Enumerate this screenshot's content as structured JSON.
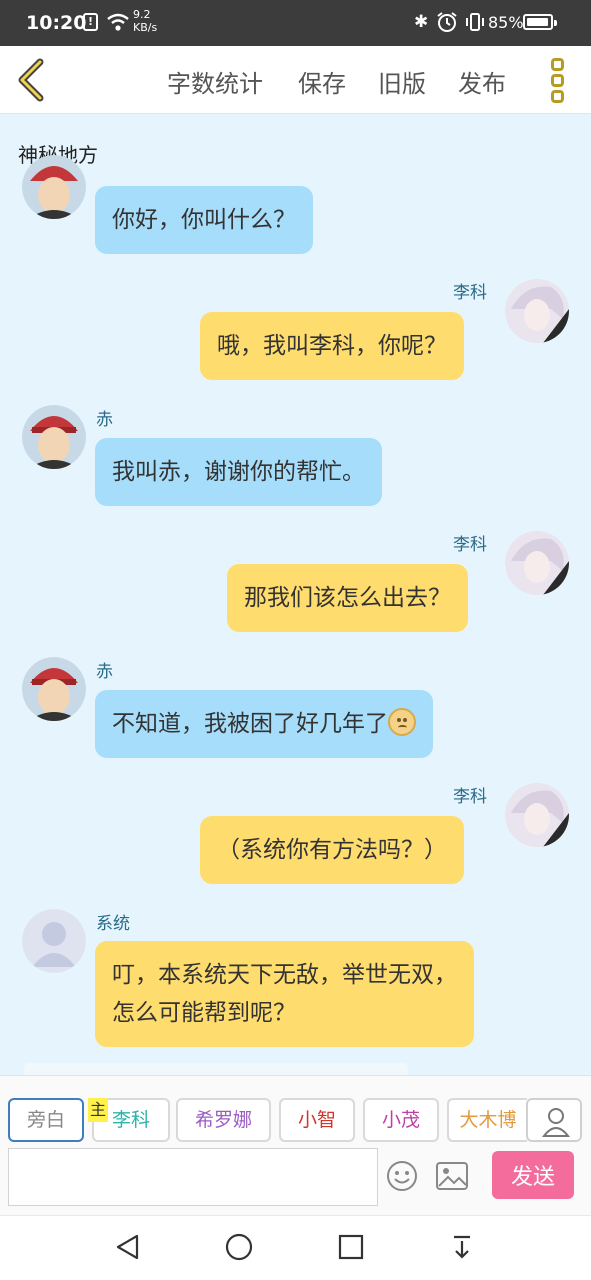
{
  "status_bar": {
    "time": "10:20",
    "alert_glyph": "!",
    "net_speed_value": "9.2",
    "net_speed_unit": "KB/s",
    "bluetooth_glyph": "✱",
    "battery": "85%",
    "battery_level": 0.85
  },
  "toolbar": {
    "back_icon": "chevron-left-icon",
    "word_count": "字数统计",
    "save": "保存",
    "old_version": "旧版",
    "publish": "发布",
    "more_icon": "more-vertical-icon"
  },
  "chat": {
    "title": "神秘地方",
    "messages": [
      {
        "speaker": "",
        "side": "left",
        "text": "你好，你叫什么？",
        "color": "#a6ddfa"
      },
      {
        "speaker": "李科",
        "side": "right",
        "text": "哦，我叫李科，你呢？",
        "color": "#ffdc6e"
      },
      {
        "speaker": "赤",
        "side": "left",
        "text": "我叫赤，谢谢你的帮忙。",
        "color": "#a6ddfa"
      },
      {
        "speaker": "李科",
        "side": "right",
        "text": "那我们该怎么出去？",
        "color": "#ffdc6e"
      },
      {
        "speaker": "赤",
        "side": "left",
        "text": "不知道，我被困了好几年了",
        "emoji": "worried-face-icon",
        "color": "#a6ddfa"
      },
      {
        "speaker": "李科",
        "side": "right",
        "text": "（系统你有方法吗？）",
        "color": "#ffdc6e"
      },
      {
        "speaker": "系统",
        "side": "left",
        "text_line1": "叮，本系统天下无敌，举世无双，",
        "text_line2": "怎么可能帮到呢？",
        "color": "#ffdc6e"
      }
    ]
  },
  "characters": [
    {
      "label": "旁白",
      "color": "#888888"
    },
    {
      "label": "李科",
      "color": "#2fb3a8",
      "tag": "主"
    },
    {
      "label": "希罗娜",
      "color": "#9b5cc4"
    },
    {
      "label": "小智",
      "color": "#d2342c"
    },
    {
      "label": "小茂",
      "color": "#c03fa7"
    },
    {
      "label": "大木博",
      "color": "#e39a3d"
    }
  ],
  "input": {
    "placeholder": "",
    "emoji_icon": "smiley-icon",
    "image_icon": "image-icon",
    "send": "发送"
  },
  "nav": {
    "back": "back-triangle-icon",
    "home": "home-circle-icon",
    "recents": "recents-square-icon",
    "download": "download-arrow-icon"
  }
}
